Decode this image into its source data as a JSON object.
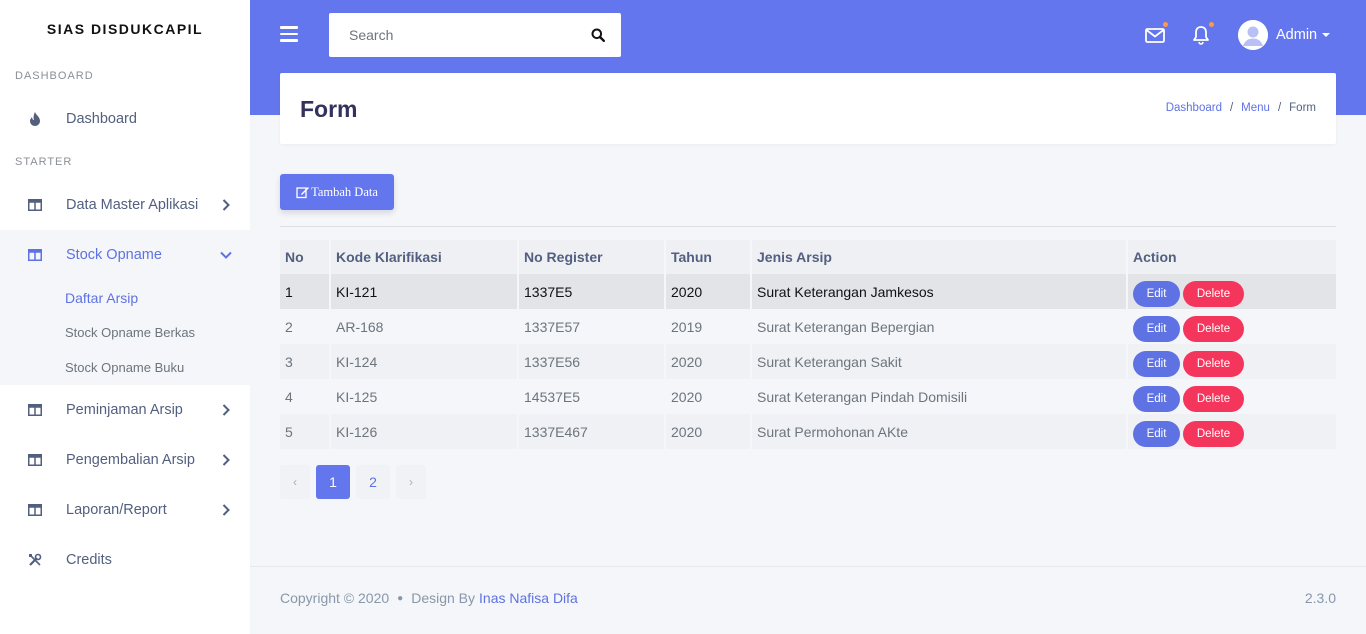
{
  "sidebar": {
    "brand": "SIAS DISDUKCAPIL",
    "section_dashboard": "DASHBOARD",
    "section_starter": "STARTER",
    "items": {
      "dashboard": "Dashboard",
      "data_master": "Data Master Aplikasi",
      "stock_opname": "Stock Opname",
      "peminjaman": "Peminjaman Arsip",
      "pengembalian": "Pengembalian Arsip",
      "laporan": "Laporan/Report",
      "credits": "Credits"
    },
    "sub_items": {
      "daftar_arsip": "Daftar Arsip",
      "so_berkas": "Stock Opname Berkas",
      "so_buku": "Stock Opname Buku"
    },
    "active_sub": "Daftar Arsip"
  },
  "header": {
    "search_placeholder": "Search",
    "user_name": "Admin"
  },
  "page": {
    "title": "Form",
    "breadcrumb": [
      "Dashboard",
      "Menu",
      "Form"
    ]
  },
  "toolbar": {
    "add_label": "Tambah Data"
  },
  "table": {
    "headers": [
      "No",
      "Kode Klarifikasi",
      "No Register",
      "Tahun",
      "Jenis Arsip",
      "Action"
    ],
    "rows": [
      {
        "no": "1",
        "kode": "KI-121",
        "register": "1337E5",
        "tahun": "2020",
        "jenis": "Surat Keterangan Jamkesos"
      },
      {
        "no": "2",
        "kode": "AR-168",
        "register": "1337E57",
        "tahun": "2019",
        "jenis": "Surat Keterangan Bepergian"
      },
      {
        "no": "3",
        "kode": "KI-124",
        "register": "1337E56",
        "tahun": "2020",
        "jenis": "Surat Keterangan Sakit"
      },
      {
        "no": "4",
        "kode": "KI-125",
        "register": "14537E5",
        "tahun": "2020",
        "jenis": "Surat Keterangan Pindah Domisili"
      },
      {
        "no": "5",
        "kode": "KI-126",
        "register": "1337E467",
        "tahun": "2020",
        "jenis": "Surat Permohonan AKte"
      }
    ],
    "edit_label": "Edit",
    "delete_label": "Delete"
  },
  "pagination": {
    "prev": "‹",
    "pages": [
      "1",
      "2"
    ],
    "next": "›",
    "current": "1"
  },
  "footer": {
    "copyright": "Copyright © 2020",
    "design_by": "Design By",
    "author": "Inas Nafisa Difa",
    "version": "2.3.0"
  },
  "colors": {
    "primary": "#6476ee",
    "danger": "#f5365c",
    "notification_dot": "#fb9a4b"
  }
}
